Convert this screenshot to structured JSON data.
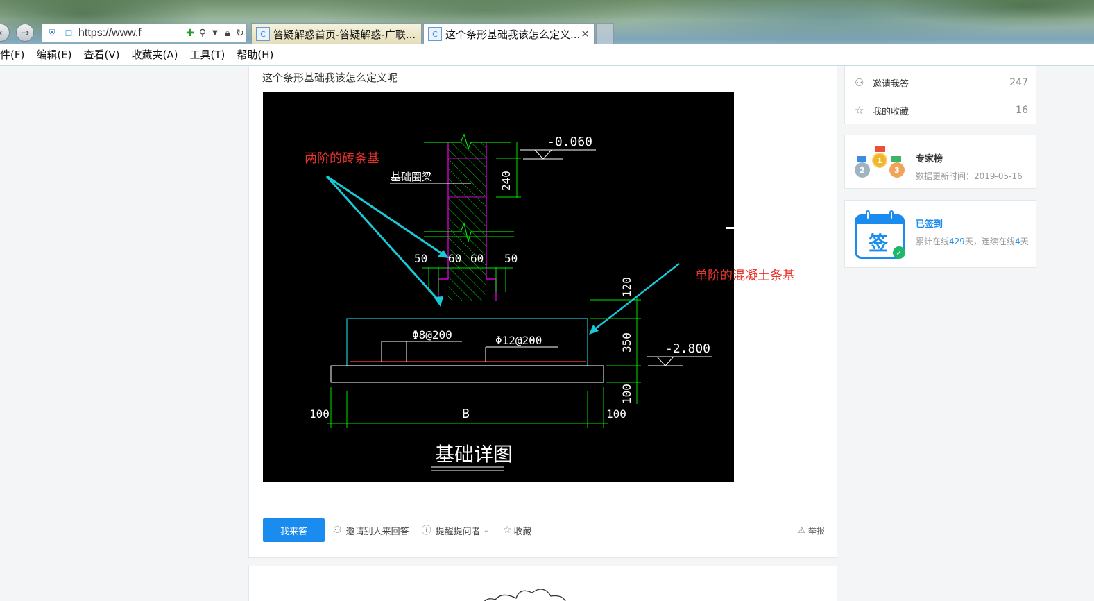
{
  "browser": {
    "url": "https://www.f",
    "tabs": [
      {
        "label": "答疑解惑首页-答疑解惑-广联..."
      },
      {
        "label": "这个条形基础我该怎么定义..."
      }
    ],
    "menu": [
      "件(F)",
      "编辑(E)",
      "查看(V)",
      "收藏夹(A)",
      "工具(T)",
      "帮助(H)"
    ]
  },
  "question": {
    "title": "这个条形基础我该怎么定义呢"
  },
  "drawing": {
    "annotations": {
      "brick_foundation": "两阶的砖条基",
      "concrete_foundation": "单阶的混凝土条基"
    },
    "labels": {
      "beam": "基础圈梁",
      "elev_top": "-0.060",
      "elev_bottom": "-2.800",
      "dim_240": "240",
      "dim_50_left": "50",
      "dim_60_left": "60",
      "dim_60_right": "60",
      "dim_50_right": "50",
      "dim_120": "120",
      "dim_350": "350",
      "dim_100_right_v": "100",
      "rebar_dist": "Φ8@200",
      "rebar_main": "Φ12@200",
      "dim_100_left": "100",
      "dim_b": "B",
      "dim_100_right": "100",
      "caption": "基础详图"
    }
  },
  "actions": {
    "answer": "我来答",
    "invite": "邀请别人来回答",
    "remind": "提醒提问者",
    "favorite": "收藏",
    "report": "举报"
  },
  "sidebar": {
    "invite_me": {
      "label": "邀请我答",
      "count": "247"
    },
    "my_favorites": {
      "label": "我的收藏",
      "count": "16"
    },
    "experts": {
      "title": "专家榜",
      "updated": "数据更新时间：2019-05-16"
    },
    "signin": {
      "title": "已签到",
      "prefix": "累计在线",
      "days": "429",
      "mid": "天，连续在线",
      "streak": "4",
      "suffix": "天",
      "icon_char": "签"
    },
    "medals": [
      "2",
      "1",
      "3"
    ]
  },
  "colors": {
    "accent": "#1a8cf0",
    "annotation_red": "#e8322c",
    "arrow_cyan": "#19c9d6",
    "cad_green": "#00e000",
    "cad_magenta": "#d000d0"
  }
}
